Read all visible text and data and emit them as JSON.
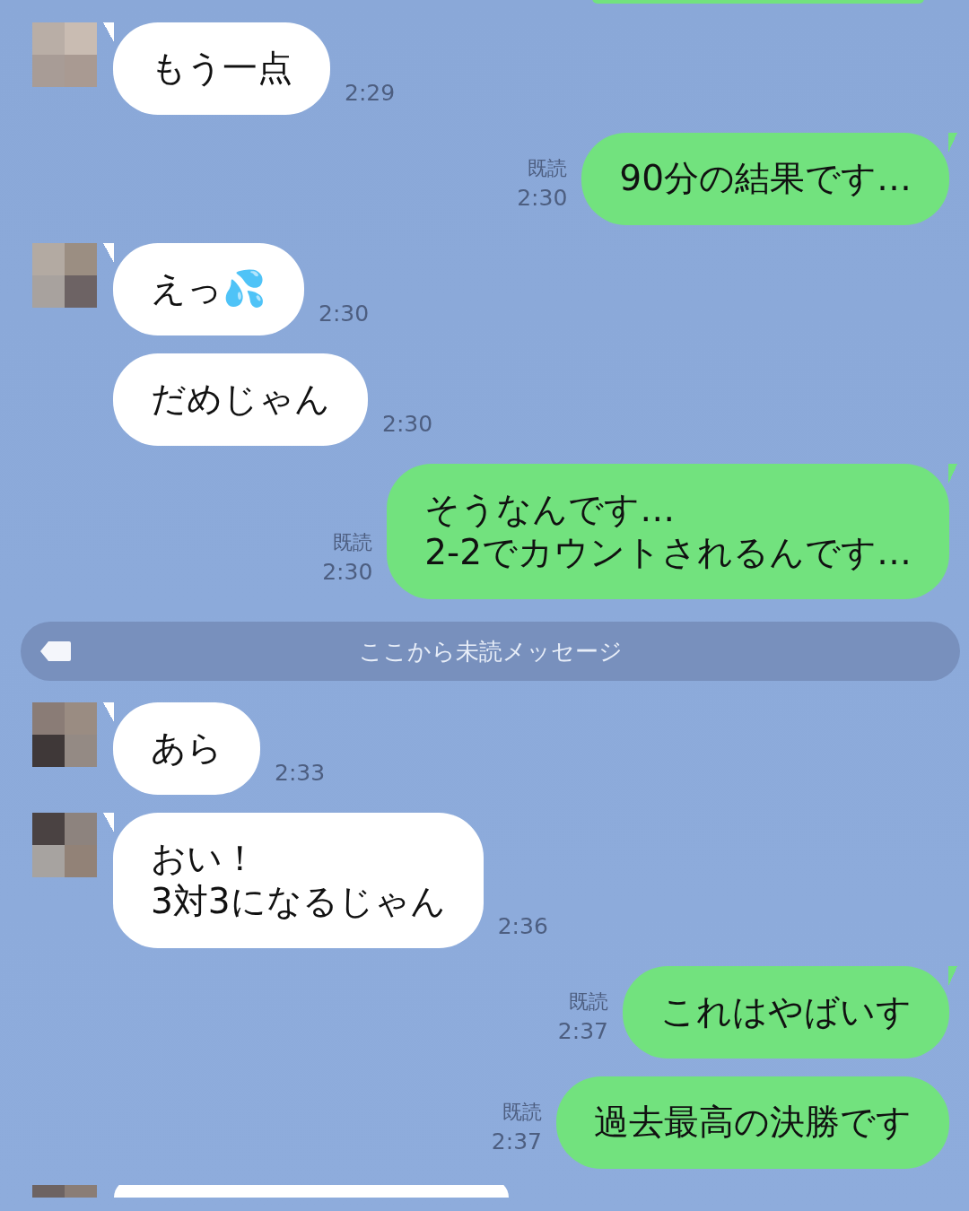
{
  "messages": [
    {
      "kind": "sent",
      "cut": true
    },
    {
      "kind": "received",
      "avatar": true,
      "lines": [
        "もう一点"
      ],
      "time": "2:29"
    },
    {
      "kind": "sent",
      "read": "既読",
      "lines": [
        "90分の結果です…"
      ],
      "time": "2:30"
    },
    {
      "kind": "received",
      "avatar": true,
      "lines": [
        "えっ💦"
      ],
      "time": "2:30"
    },
    {
      "kind": "received",
      "avatar": false,
      "lines": [
        "だめじゃん"
      ],
      "time": "2:30"
    },
    {
      "kind": "sent",
      "read": "既読",
      "lines": [
        "そうなんです…",
        "2-2でカウントされるんです…"
      ],
      "time": "2:30"
    },
    {
      "kind": "divider",
      "text": "ここから未読メッセージ"
    },
    {
      "kind": "received",
      "avatar": true,
      "lines": [
        "あら"
      ],
      "time": "2:33"
    },
    {
      "kind": "received",
      "avatar": true,
      "lines": [
        "おい！",
        "3対3になるじゃん"
      ],
      "time": "2:36"
    },
    {
      "kind": "sent",
      "read": "既読",
      "lines": [
        "これはやばいす"
      ],
      "time": "2:37"
    },
    {
      "kind": "sent",
      "read": "既読",
      "lines": [
        "過去最高の決勝です"
      ],
      "time": "2:37"
    },
    {
      "kind": "received",
      "avatar": true,
      "cut": true
    }
  ]
}
